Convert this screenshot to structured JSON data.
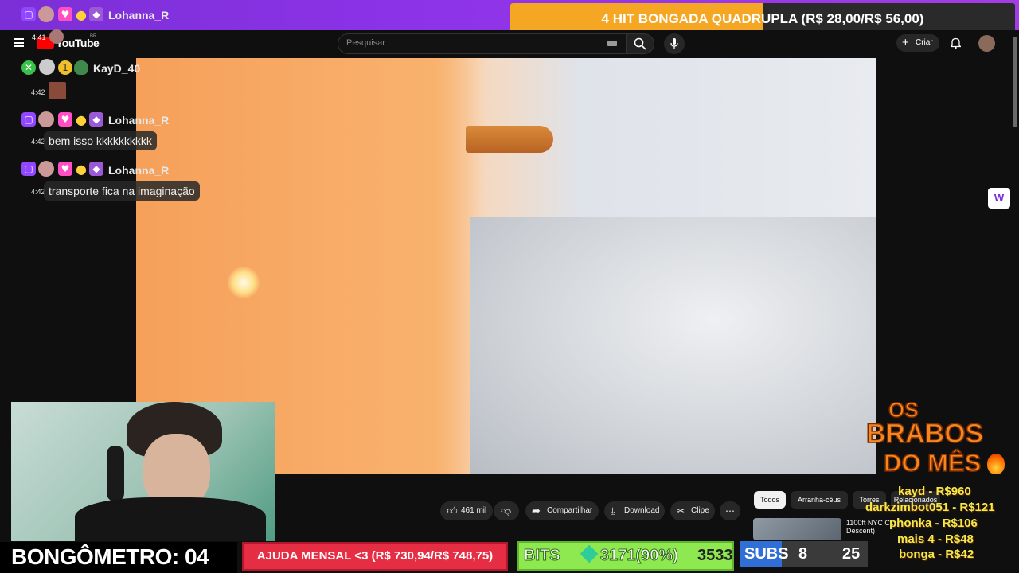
{
  "overlay": {
    "top_user": "Lohanna_R",
    "goal": {
      "text": "4 HIT BONGADA QUADRUPLA (R$ 28,00/R$ 56,00)",
      "progress": 0.5,
      "fill_color": "#f5a623"
    }
  },
  "youtube": {
    "time_top": "4:41",
    "logo": "YouTube",
    "logo_region": "BR",
    "search_placeholder": "Pesquisar",
    "create_label": "Criar",
    "actions": {
      "likes": "461 mil",
      "share": "Compartilhar",
      "download": "Download",
      "clip": "Clipe"
    },
    "chips": [
      "Todos",
      "Arranha-céus",
      "Torres",
      "Relacionados"
    ],
    "related_title": "1100ft NYC C... Descent)"
  },
  "chat": [
    {
      "time": "4:42",
      "user": "KayD_40",
      "message": "",
      "badges": [
        "green-x-badge",
        "avatar-badge",
        "gold-1-badge",
        "shield-badge"
      ]
    },
    {
      "time": "4:42",
      "user": "Lohanna_R",
      "message": "bem isso kkkkkkkkkk",
      "badges": [
        "twitch-badge",
        "avatar-badge",
        "heart-badge",
        "emoji-badge",
        "diamond-badge"
      ]
    },
    {
      "time": "4:42",
      "user": "Lohanna_R",
      "message": "transporte fica na imaginação",
      "badges": [
        "twitch-badge",
        "avatar-badge",
        "heart-badge",
        "emoji-badge",
        "diamond-badge"
      ]
    }
  ],
  "bottom": {
    "bongometro": "BONGÔMETRO: 04",
    "ajuda": "AJUDA MENSAL <3 (R$ 730,94/R$ 748,75)",
    "bits_label": "BITS",
    "bits_value": "3171(90%)",
    "bits_total": "3533",
    "subs_label": "SUBS",
    "subs_value": "8",
    "subs_total": "25"
  },
  "brabos": {
    "title": [
      "OS",
      "BRABOS",
      "DO MÊS"
    ],
    "list": [
      "kayd - R$960",
      "darkzimbot051 - R$121",
      "phonka - R$106",
      "mais 4 - R$48",
      "bonga - R$42"
    ]
  },
  "colors": {
    "twitch_purple": "#8c33e8",
    "ajuda_red": "#e52d44",
    "bits_green": "#8ee84f",
    "brabos_orange": "#f5871f"
  }
}
